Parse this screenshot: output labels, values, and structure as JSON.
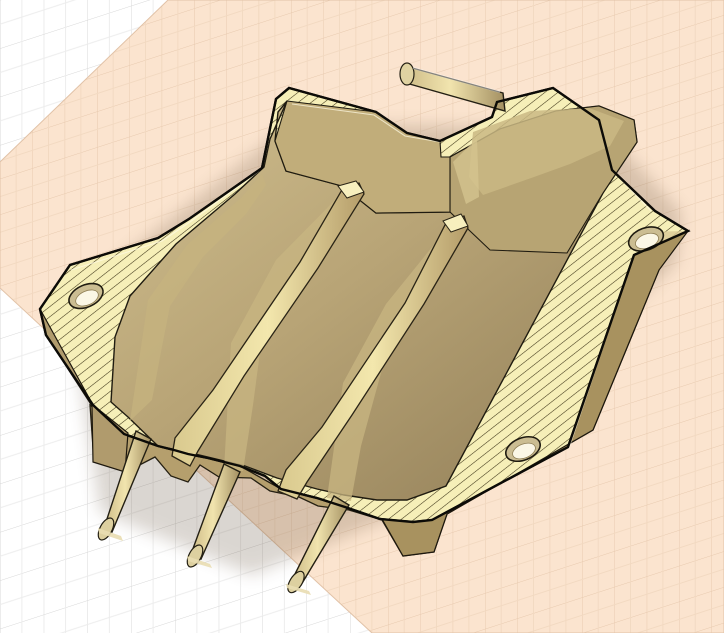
{
  "viewport": {
    "kind": "3d-cad-viewport",
    "view": "section-view",
    "background_color": "#ffffff",
    "sketch_plane_color": "#fbe4cf",
    "grid_line_color": "#d7d7d7",
    "sketch_grid_line_color": "#e7c9ae"
  },
  "model": {
    "part": "molded-housing-section",
    "body_color": "#f6efb8",
    "section_hatch_color": "#3c3316",
    "cavity_color": "#b9a77b",
    "visible_features": [
      "section-hatch-face",
      "main-cavity",
      "two-internal-ribs",
      "three-pins",
      "three-mounting-holes",
      "side-pin"
    ]
  }
}
